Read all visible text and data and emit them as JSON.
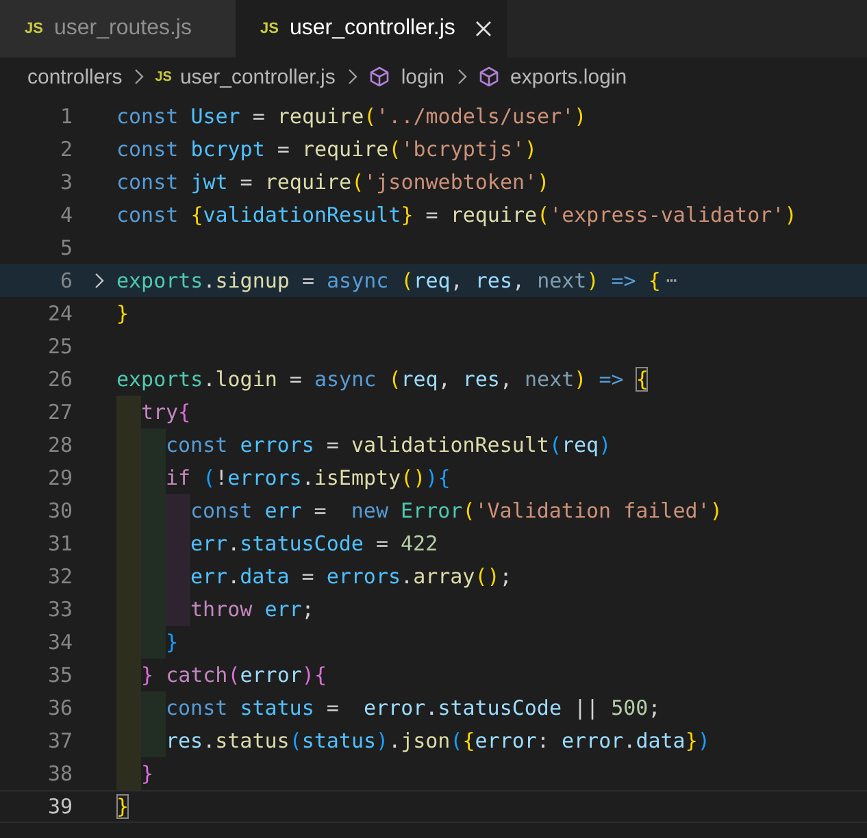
{
  "tabs": [
    {
      "badge": "JS",
      "label": "user_routes.js",
      "selected": false
    },
    {
      "badge": "JS",
      "label": "user_controller.js",
      "selected": true
    }
  ],
  "breadcrumbs": [
    {
      "kind": "folder",
      "label": "controllers"
    },
    {
      "kind": "file",
      "badge": "JS",
      "label": "user_controller.js"
    },
    {
      "kind": "symbol",
      "label": "login"
    },
    {
      "kind": "symbol",
      "label": "exports.login"
    }
  ],
  "editor": {
    "lines": [
      {
        "number": "1",
        "kind": "plain",
        "tokens": [
          {
            "text": "const ",
            "kind": "kw"
          },
          {
            "text": "User",
            "kind": "var"
          },
          {
            "text": " = ",
            "kind": "p"
          },
          {
            "text": "require",
            "kind": "fn"
          },
          {
            "text": "(",
            "kind": "b1"
          },
          {
            "text": "'../models/user'",
            "kind": "str"
          },
          {
            "text": ")",
            "kind": "b1"
          }
        ]
      },
      {
        "number": "2",
        "kind": "plain",
        "tokens": [
          {
            "text": "const ",
            "kind": "kw"
          },
          {
            "text": "bcrypt",
            "kind": "var"
          },
          {
            "text": " = ",
            "kind": "p"
          },
          {
            "text": "require",
            "kind": "fn"
          },
          {
            "text": "(",
            "kind": "b1"
          },
          {
            "text": "'bcryptjs'",
            "kind": "str"
          },
          {
            "text": ")",
            "kind": "b1"
          }
        ]
      },
      {
        "number": "3",
        "kind": "plain",
        "tokens": [
          {
            "text": "const ",
            "kind": "kw"
          },
          {
            "text": "jwt",
            "kind": "var"
          },
          {
            "text": " = ",
            "kind": "p"
          },
          {
            "text": "require",
            "kind": "fn"
          },
          {
            "text": "(",
            "kind": "b1"
          },
          {
            "text": "'jsonwebtoken'",
            "kind": "str"
          },
          {
            "text": ")",
            "kind": "b1"
          }
        ]
      },
      {
        "number": "4",
        "kind": "plain",
        "tokens": [
          {
            "text": "const ",
            "kind": "kw"
          },
          {
            "text": "{",
            "kind": "b1"
          },
          {
            "text": "validationResult",
            "kind": "var"
          },
          {
            "text": "}",
            "kind": "b1"
          },
          {
            "text": " = ",
            "kind": "p"
          },
          {
            "text": "require",
            "kind": "fn"
          },
          {
            "text": "(",
            "kind": "b1"
          },
          {
            "text": "'express-validator'",
            "kind": "str"
          },
          {
            "text": ")",
            "kind": "b1"
          }
        ]
      },
      {
        "number": "5",
        "kind": "plain"
      },
      {
        "number": "6",
        "kind": "folded",
        "fold_marker": "⋯",
        "tokens": [
          {
            "text": "exports",
            "kind": "cls"
          },
          {
            "text": ".",
            "kind": "p"
          },
          {
            "text": "signup",
            "kind": "fn"
          },
          {
            "text": " = ",
            "kind": "p"
          },
          {
            "text": "async ",
            "kind": "kw"
          },
          {
            "text": "(",
            "kind": "b1"
          },
          {
            "text": "req",
            "kind": "param"
          },
          {
            "text": ", ",
            "kind": "p"
          },
          {
            "text": "res",
            "kind": "param"
          },
          {
            "text": ", ",
            "kind": "p"
          },
          {
            "text": "next",
            "kind": "dim"
          },
          {
            "text": ") ",
            "kind": "b1"
          },
          {
            "text": "=> ",
            "kind": "kw"
          },
          {
            "text": "{",
            "kind": "b1"
          }
        ]
      },
      {
        "number": "24",
        "kind": "plain",
        "tokens": [
          {
            "text": "}",
            "kind": "b1"
          }
        ]
      },
      {
        "number": "25",
        "kind": "plain"
      },
      {
        "number": "26",
        "kind": "plain",
        "tokens": [
          {
            "text": "exports",
            "kind": "cls"
          },
          {
            "text": ".",
            "kind": "p"
          },
          {
            "text": "login",
            "kind": "fn"
          },
          {
            "text": " = ",
            "kind": "p"
          },
          {
            "text": "async ",
            "kind": "kw"
          },
          {
            "text": "(",
            "kind": "b1"
          },
          {
            "text": "req",
            "kind": "param"
          },
          {
            "text": ", ",
            "kind": "p"
          },
          {
            "text": "res",
            "kind": "param"
          },
          {
            "text": ", ",
            "kind": "p"
          },
          {
            "text": "next",
            "kind": "dim"
          },
          {
            "text": ") ",
            "kind": "b1"
          },
          {
            "text": "=> ",
            "kind": "kw"
          },
          {
            "text": "{",
            "kind": "match"
          }
        ]
      },
      {
        "number": "27",
        "kind": "plain",
        "guides": [
          {
            "color": "#2e2e1f"
          }
        ],
        "tokens": [
          {
            "text": "try",
            "kind": "ctl"
          },
          {
            "text": "{",
            "kind": "b2"
          }
        ]
      },
      {
        "number": "28",
        "kind": "plain",
        "guides": [
          {
            "color": "#2e2e1f"
          },
          {
            "color": "#222d23"
          }
        ],
        "tokens": [
          {
            "text": "const ",
            "kind": "kw"
          },
          {
            "text": "errors",
            "kind": "var"
          },
          {
            "text": " = ",
            "kind": "p"
          },
          {
            "text": "validationResult",
            "kind": "fn"
          },
          {
            "text": "(",
            "kind": "b3"
          },
          {
            "text": "req",
            "kind": "param"
          },
          {
            "text": ")",
            "kind": "b3"
          }
        ]
      },
      {
        "number": "29",
        "kind": "plain",
        "guides": [
          {
            "color": "#2e2e1f"
          },
          {
            "color": "#222d23"
          }
        ],
        "tokens": [
          {
            "text": "if ",
            "kind": "ctl"
          },
          {
            "text": "(",
            "kind": "b3"
          },
          {
            "text": "!",
            "kind": "p"
          },
          {
            "text": "errors",
            "kind": "var"
          },
          {
            "text": ".",
            "kind": "p"
          },
          {
            "text": "isEmpty",
            "kind": "fn"
          },
          {
            "text": "()",
            "kind": "b1"
          },
          {
            "text": ")",
            "kind": "b3"
          },
          {
            "text": "{",
            "kind": "b3"
          }
        ]
      },
      {
        "number": "30",
        "kind": "plain",
        "guides": [
          {
            "color": "#2e2e1f"
          },
          {
            "color": "#222d23"
          },
          {
            "color": "#2e2430"
          }
        ],
        "tokens": [
          {
            "text": "const ",
            "kind": "kw"
          },
          {
            "text": "err",
            "kind": "var"
          },
          {
            "text": " =  ",
            "kind": "p"
          },
          {
            "text": "new ",
            "kind": "kw"
          },
          {
            "text": "Error",
            "kind": "cls"
          },
          {
            "text": "(",
            "kind": "b1"
          },
          {
            "text": "'Validation failed'",
            "kind": "str"
          },
          {
            "text": ")",
            "kind": "b1"
          }
        ]
      },
      {
        "number": "31",
        "kind": "plain",
        "guides": [
          {
            "color": "#2e2e1f"
          },
          {
            "color": "#222d23"
          },
          {
            "color": "#2e2430"
          }
        ],
        "tokens": [
          {
            "text": "err",
            "kind": "var"
          },
          {
            "text": ".",
            "kind": "p"
          },
          {
            "text": "statusCode",
            "kind": "var"
          },
          {
            "text": " = ",
            "kind": "p"
          },
          {
            "text": "422",
            "kind": "num"
          }
        ]
      },
      {
        "number": "32",
        "kind": "plain",
        "guides": [
          {
            "color": "#2e2e1f"
          },
          {
            "color": "#222d23"
          },
          {
            "color": "#2e2430"
          }
        ],
        "tokens": [
          {
            "text": "err",
            "kind": "var"
          },
          {
            "text": ".",
            "kind": "p"
          },
          {
            "text": "data",
            "kind": "var"
          },
          {
            "text": " = ",
            "kind": "p"
          },
          {
            "text": "errors",
            "kind": "var"
          },
          {
            "text": ".",
            "kind": "p"
          },
          {
            "text": "array",
            "kind": "fn"
          },
          {
            "text": "()",
            "kind": "b1"
          },
          {
            "text": ";",
            "kind": "p"
          }
        ]
      },
      {
        "number": "33",
        "kind": "plain",
        "guides": [
          {
            "color": "#2e2e1f"
          },
          {
            "color": "#222d23"
          },
          {
            "color": "#2e2430"
          }
        ],
        "tokens": [
          {
            "text": "throw ",
            "kind": "ctl"
          },
          {
            "text": "err",
            "kind": "var"
          },
          {
            "text": ";",
            "kind": "p"
          }
        ]
      },
      {
        "number": "34",
        "kind": "plain",
        "guides": [
          {
            "color": "#2e2e1f"
          },
          {
            "color": "#222d23"
          }
        ],
        "tokens": [
          {
            "text": "}",
            "kind": "b3"
          }
        ]
      },
      {
        "number": "35",
        "kind": "plain",
        "guides": [
          {
            "color": "#2e2e1f"
          }
        ],
        "tokens": [
          {
            "text": "} ",
            "kind": "b2"
          },
          {
            "text": "catch",
            "kind": "ctl"
          },
          {
            "text": "(",
            "kind": "b2"
          },
          {
            "text": "error",
            "kind": "param"
          },
          {
            "text": ")",
            "kind": "b2"
          },
          {
            "text": "{",
            "kind": "b2"
          }
        ]
      },
      {
        "number": "36",
        "kind": "plain",
        "guides": [
          {
            "color": "#2e2e1f"
          },
          {
            "color": "#222d23"
          }
        ],
        "tokens": [
          {
            "text": "const ",
            "kind": "kw"
          },
          {
            "text": "status",
            "kind": "var"
          },
          {
            "text": " =  ",
            "kind": "p"
          },
          {
            "text": "error",
            "kind": "param"
          },
          {
            "text": ".",
            "kind": "p"
          },
          {
            "text": "statusCode",
            "kind": "param"
          },
          {
            "text": " || ",
            "kind": "p"
          },
          {
            "text": "500",
            "kind": "num"
          },
          {
            "text": ";",
            "kind": "p"
          }
        ]
      },
      {
        "number": "37",
        "kind": "plain",
        "guides": [
          {
            "color": "#2e2e1f"
          },
          {
            "color": "#222d23"
          }
        ],
        "tokens": [
          {
            "text": "res",
            "kind": "param"
          },
          {
            "text": ".",
            "kind": "p"
          },
          {
            "text": "status",
            "kind": "fn"
          },
          {
            "text": "(",
            "kind": "b3"
          },
          {
            "text": "status",
            "kind": "var"
          },
          {
            "text": ")",
            "kind": "b3"
          },
          {
            "text": ".",
            "kind": "p"
          },
          {
            "text": "json",
            "kind": "fn"
          },
          {
            "text": "(",
            "kind": "b3"
          },
          {
            "text": "{",
            "kind": "b1"
          },
          {
            "text": "error",
            "kind": "param"
          },
          {
            "text": ": ",
            "kind": "p"
          },
          {
            "text": "error",
            "kind": "param"
          },
          {
            "text": ".",
            "kind": "p"
          },
          {
            "text": "data",
            "kind": "param"
          },
          {
            "text": "}",
            "kind": "b1"
          },
          {
            "text": ")",
            "kind": "b3"
          }
        ]
      },
      {
        "number": "38",
        "kind": "plain",
        "guides": [
          {
            "color": "#2e2e1f"
          }
        ],
        "tokens": [
          {
            "text": "}",
            "kind": "b2"
          }
        ]
      },
      {
        "number": "39",
        "kind": "current",
        "tokens": [
          {
            "text": "}",
            "kind": "match"
          }
        ]
      }
    ]
  }
}
